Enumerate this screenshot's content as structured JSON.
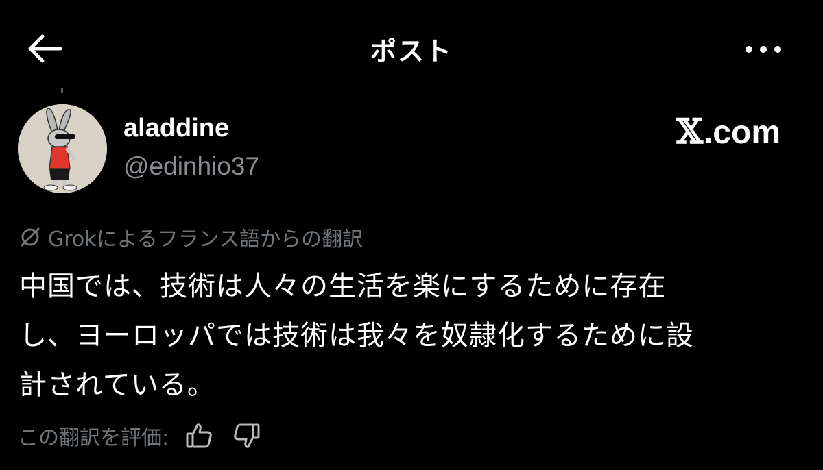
{
  "header": {
    "title": "ポスト"
  },
  "author": {
    "display_name": "aladdine",
    "handle": "@edinhio37"
  },
  "brand": {
    "x_letter": "𝕏",
    "domain": ".com"
  },
  "translation": {
    "label": "Grokによるフランス語からの翻訳"
  },
  "post": {
    "lines": [
      "中国では、技術は人々の生活を楽にするために存在",
      "し、ヨーロッパでは技術は我々を奴隷化するために設",
      "計されている。"
    ]
  },
  "rating": {
    "label": "この翻訳を評価:"
  },
  "colors": {
    "background": "#000000",
    "text_primary": "#ffffff",
    "text_secondary": "#8b8f94",
    "text_muted": "#707579"
  },
  "icons": {
    "back": "back-arrow-icon",
    "more": "more-options-icon",
    "grok": "grok-icon",
    "thumbs_up": "thumbs-up-icon",
    "thumbs_down": "thumbs-down-icon"
  }
}
